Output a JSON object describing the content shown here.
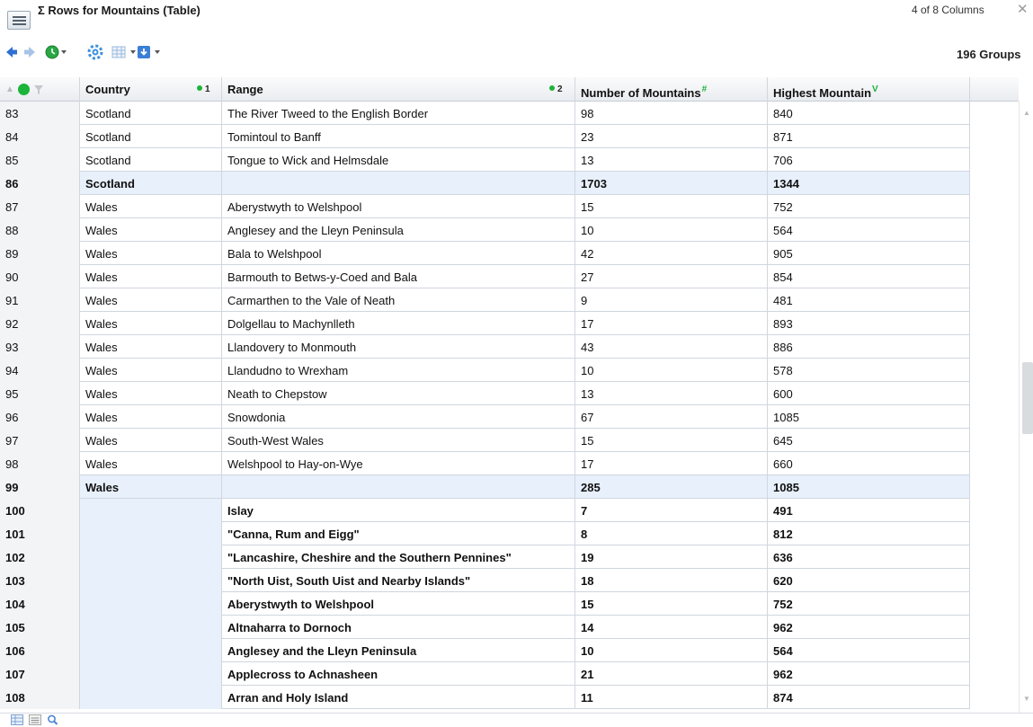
{
  "window": {
    "title": "Σ Rows for Mountains (Table)",
    "columns_info": "4 of 8 Columns",
    "groups_info": "196 Groups"
  },
  "icons": {
    "menu": "hamburger-menu-icon",
    "close": "close-icon",
    "back": "back-arrow-icon",
    "forward": "forward-arrow-icon",
    "history": "history-icon",
    "settings": "gear-icon",
    "layout": "table-layout-icon",
    "download": "download-icon"
  },
  "colors": {
    "summary_row_bg": "#e8f0fb",
    "accent_blue": "#2f6fd1",
    "status_green": "#1cb43a"
  },
  "header": {
    "country": {
      "label": "Country",
      "sort": "1"
    },
    "range": {
      "label": "Range",
      "sort": "2"
    },
    "number": {
      "label": "Number of Mountains",
      "marker": "#"
    },
    "highest": {
      "label": "Highest Mountain",
      "marker": "V"
    }
  },
  "rows": [
    {
      "idx": "83",
      "country": "Scotland",
      "range": "The River Tweed to the English Border",
      "number": "98",
      "highest": "840",
      "style": "normal"
    },
    {
      "idx": "84",
      "country": "Scotland",
      "range": "Tomintoul to Banff",
      "number": "23",
      "highest": "871",
      "style": "normal"
    },
    {
      "idx": "85",
      "country": "Scotland",
      "range": "Tongue to Wick and Helmsdale",
      "number": "13",
      "highest": "706",
      "style": "normal"
    },
    {
      "idx": "86",
      "country": "Scotland",
      "range": "",
      "number": "1703",
      "highest": "1344",
      "style": "summary"
    },
    {
      "idx": "87",
      "country": "Wales",
      "range": "Aberystwyth to Welshpool",
      "number": "15",
      "highest": "752",
      "style": "normal"
    },
    {
      "idx": "88",
      "country": "Wales",
      "range": "Anglesey and the Lleyn Peninsula",
      "number": "10",
      "highest": "564",
      "style": "normal"
    },
    {
      "idx": "89",
      "country": "Wales",
      "range": "Bala to Welshpool",
      "number": "42",
      "highest": "905",
      "style": "normal"
    },
    {
      "idx": "90",
      "country": "Wales",
      "range": "Barmouth to Betws-y-Coed and Bala",
      "number": "27",
      "highest": "854",
      "style": "normal"
    },
    {
      "idx": "91",
      "country": "Wales",
      "range": "Carmarthen to the Vale of Neath",
      "number": "9",
      "highest": "481",
      "style": "normal"
    },
    {
      "idx": "92",
      "country": "Wales",
      "range": "Dolgellau to Machynlleth",
      "number": "17",
      "highest": "893",
      "style": "normal"
    },
    {
      "idx": "93",
      "country": "Wales",
      "range": "Llandovery to Monmouth",
      "number": "43",
      "highest": "886",
      "style": "normal"
    },
    {
      "idx": "94",
      "country": "Wales",
      "range": "Llandudno to Wrexham",
      "number": "10",
      "highest": "578",
      "style": "normal"
    },
    {
      "idx": "95",
      "country": "Wales",
      "range": "Neath to Chepstow",
      "number": "13",
      "highest": "600",
      "style": "normal"
    },
    {
      "idx": "96",
      "country": "Wales",
      "range": "Snowdonia",
      "number": "67",
      "highest": "1085",
      "style": "normal"
    },
    {
      "idx": "97",
      "country": "Wales",
      "range": "South-West Wales",
      "number": "15",
      "highest": "645",
      "style": "normal"
    },
    {
      "idx": "98",
      "country": "Wales",
      "range": "Welshpool to Hay-on-Wye",
      "number": "17",
      "highest": "660",
      "style": "normal"
    },
    {
      "idx": "99",
      "country": "Wales",
      "range": "",
      "number": "285",
      "highest": "1085",
      "style": "summary"
    },
    {
      "idx": "100",
      "country": "",
      "range": "Islay",
      "number": "7",
      "highest": "491",
      "style": "bold"
    },
    {
      "idx": "101",
      "country": "",
      "range": "\"Canna, Rum and Eigg\"",
      "number": "8",
      "highest": "812",
      "style": "bold"
    },
    {
      "idx": "102",
      "country": "",
      "range": "\"Lancashire, Cheshire and the Southern Pennines\"",
      "number": "19",
      "highest": "636",
      "style": "bold"
    },
    {
      "idx": "103",
      "country": "",
      "range": "\"North Uist, South Uist and Nearby Islands\"",
      "number": "18",
      "highest": "620",
      "style": "bold"
    },
    {
      "idx": "104",
      "country": "",
      "range": "Aberystwyth to Welshpool",
      "number": "15",
      "highest": "752",
      "style": "bold"
    },
    {
      "idx": "105",
      "country": "",
      "range": "Altnaharra to Dornoch",
      "number": "14",
      "highest": "962",
      "style": "bold"
    },
    {
      "idx": "106",
      "country": "",
      "range": "Anglesey and the Lleyn Peninsula",
      "number": "10",
      "highest": "564",
      "style": "bold"
    },
    {
      "idx": "107",
      "country": "",
      "range": "Applecross to Achnasheen",
      "number": "21",
      "highest": "962",
      "style": "bold"
    },
    {
      "idx": "108",
      "country": "",
      "range": "Arran and Holy Island",
      "number": "11",
      "highest": "874",
      "style": "bold"
    }
  ]
}
